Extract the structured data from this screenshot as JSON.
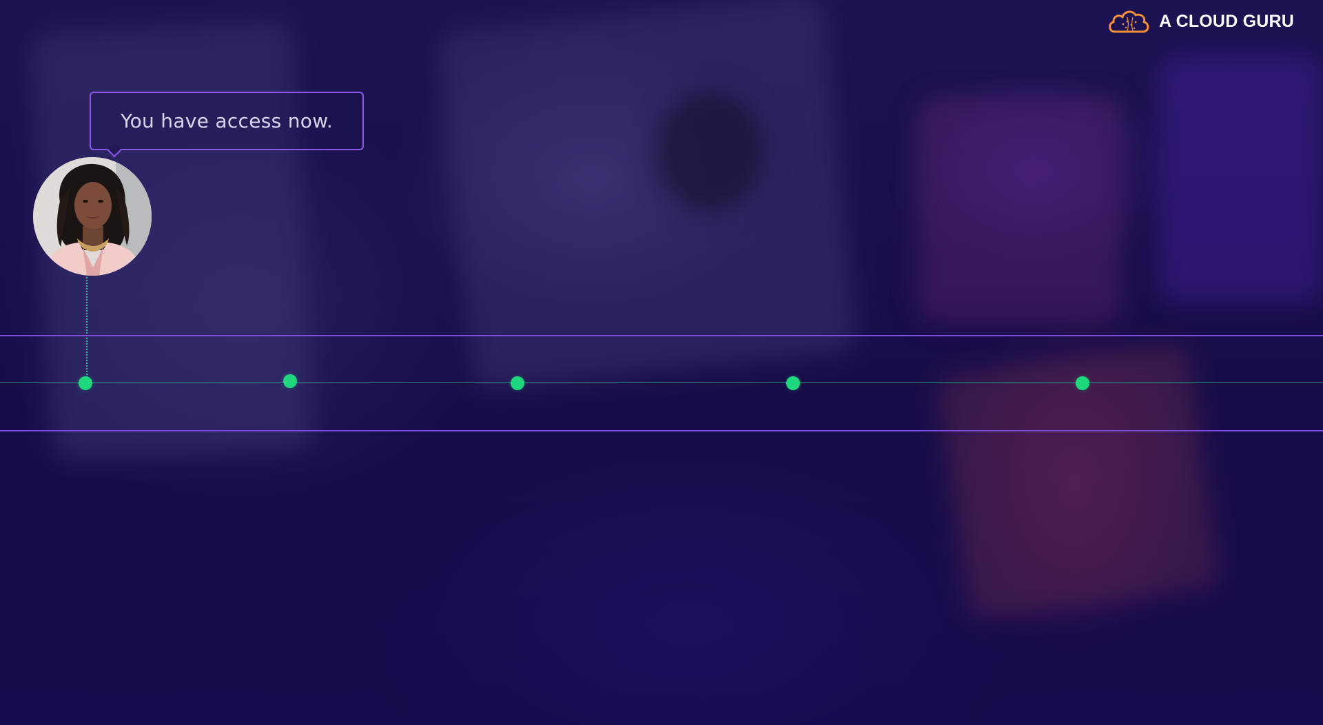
{
  "brand": {
    "name": "A CLOUD GURU",
    "icon": "cloud-logo-icon",
    "accent": "#f5903a"
  },
  "speech_bubble": {
    "text": "You have access now."
  },
  "avatar": {
    "description_icon": "presenter-avatar"
  },
  "timeline": {
    "marker_count": 5,
    "line_color": "#7d4ce0",
    "track_color": "#1f9b8a",
    "marker_color": "#1fd87e"
  }
}
